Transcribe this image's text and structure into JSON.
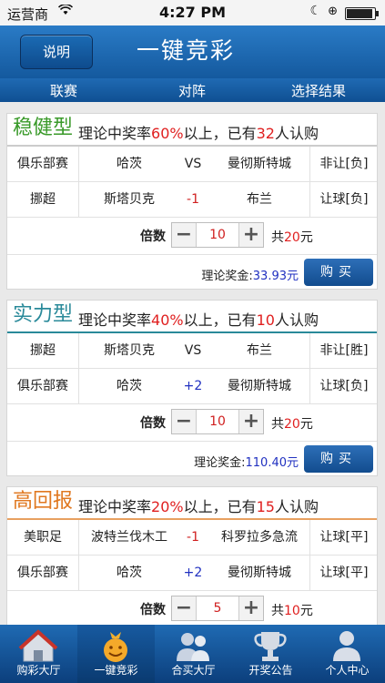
{
  "status": {
    "carrier": "运营商",
    "time": "4:27 PM",
    "battery_level": 0.95
  },
  "nav": {
    "explain_label": "说明",
    "title": "一键竞彩"
  },
  "columns": {
    "league": "联赛",
    "matchup": "对阵",
    "result": "选择结果"
  },
  "cards": [
    {
      "title": "稳健型",
      "title_color": "#3a9a2a",
      "desc_prefix": "理论中奖率",
      "rate": "60%",
      "desc_mid": "以上，已有",
      "count": "32",
      "desc_suffix": "人认购",
      "matches": [
        {
          "league": "俱乐部赛",
          "home": "哈茨",
          "odds": "VS",
          "away": "曼彻斯特城",
          "pick": "非让[负]"
        },
        {
          "league": "挪超",
          "home": "斯塔贝克",
          "odds": "-1",
          "away": "布兰",
          "pick": "让球[负]"
        }
      ],
      "mult_label": "倍数",
      "multiplier": "10",
      "total_prefix": "共",
      "total_amount": "20",
      "total_suffix": "元",
      "prize_label": "理论奖金:",
      "prize_amount": "33.93元",
      "buy_label": "购买"
    },
    {
      "title": "实力型",
      "title_color": "#2a8a9a",
      "desc_prefix": "理论中奖率",
      "rate": "40%",
      "desc_mid": "以上，已有",
      "count": "10",
      "desc_suffix": "人认购",
      "matches": [
        {
          "league": "挪超",
          "home": "斯塔贝克",
          "odds": "VS",
          "away": "布兰",
          "pick": "非让[胜]"
        },
        {
          "league": "俱乐部赛",
          "home": "哈茨",
          "odds": "+2",
          "away": "曼彻斯特城",
          "pick": "让球[负]"
        }
      ],
      "mult_label": "倍数",
      "multiplier": "10",
      "total_prefix": "共",
      "total_amount": "20",
      "total_suffix": "元",
      "prize_label": "理论奖金:",
      "prize_amount": "110.40元",
      "buy_label": "购买"
    },
    {
      "title": "高回报",
      "title_color": "#e07820",
      "desc_prefix": "理论中奖率",
      "rate": "20%",
      "desc_mid": "以上，已有",
      "count": "15",
      "desc_suffix": "人认购",
      "matches": [
        {
          "league": "美职足",
          "home": "波特兰伐木工",
          "odds": "-1",
          "away": "科罗拉多急流",
          "pick": "让球[平]"
        },
        {
          "league": "俱乐部赛",
          "home": "哈茨",
          "odds": "+2",
          "away": "曼彻斯特城",
          "pick": "让球[平]"
        }
      ],
      "mult_label": "倍数",
      "multiplier": "5",
      "total_prefix": "共",
      "total_amount": "10",
      "total_suffix": "元"
    }
  ],
  "tabs": [
    {
      "label": "购彩大厅",
      "icon": "house-icon"
    },
    {
      "label": "一键竞彩",
      "icon": "smiley-bag-icon",
      "active": true
    },
    {
      "label": "合买大厅",
      "icon": "people-icon"
    },
    {
      "label": "开奖公告",
      "icon": "trophy-icon"
    },
    {
      "label": "个人中心",
      "icon": "person-icon"
    }
  ]
}
